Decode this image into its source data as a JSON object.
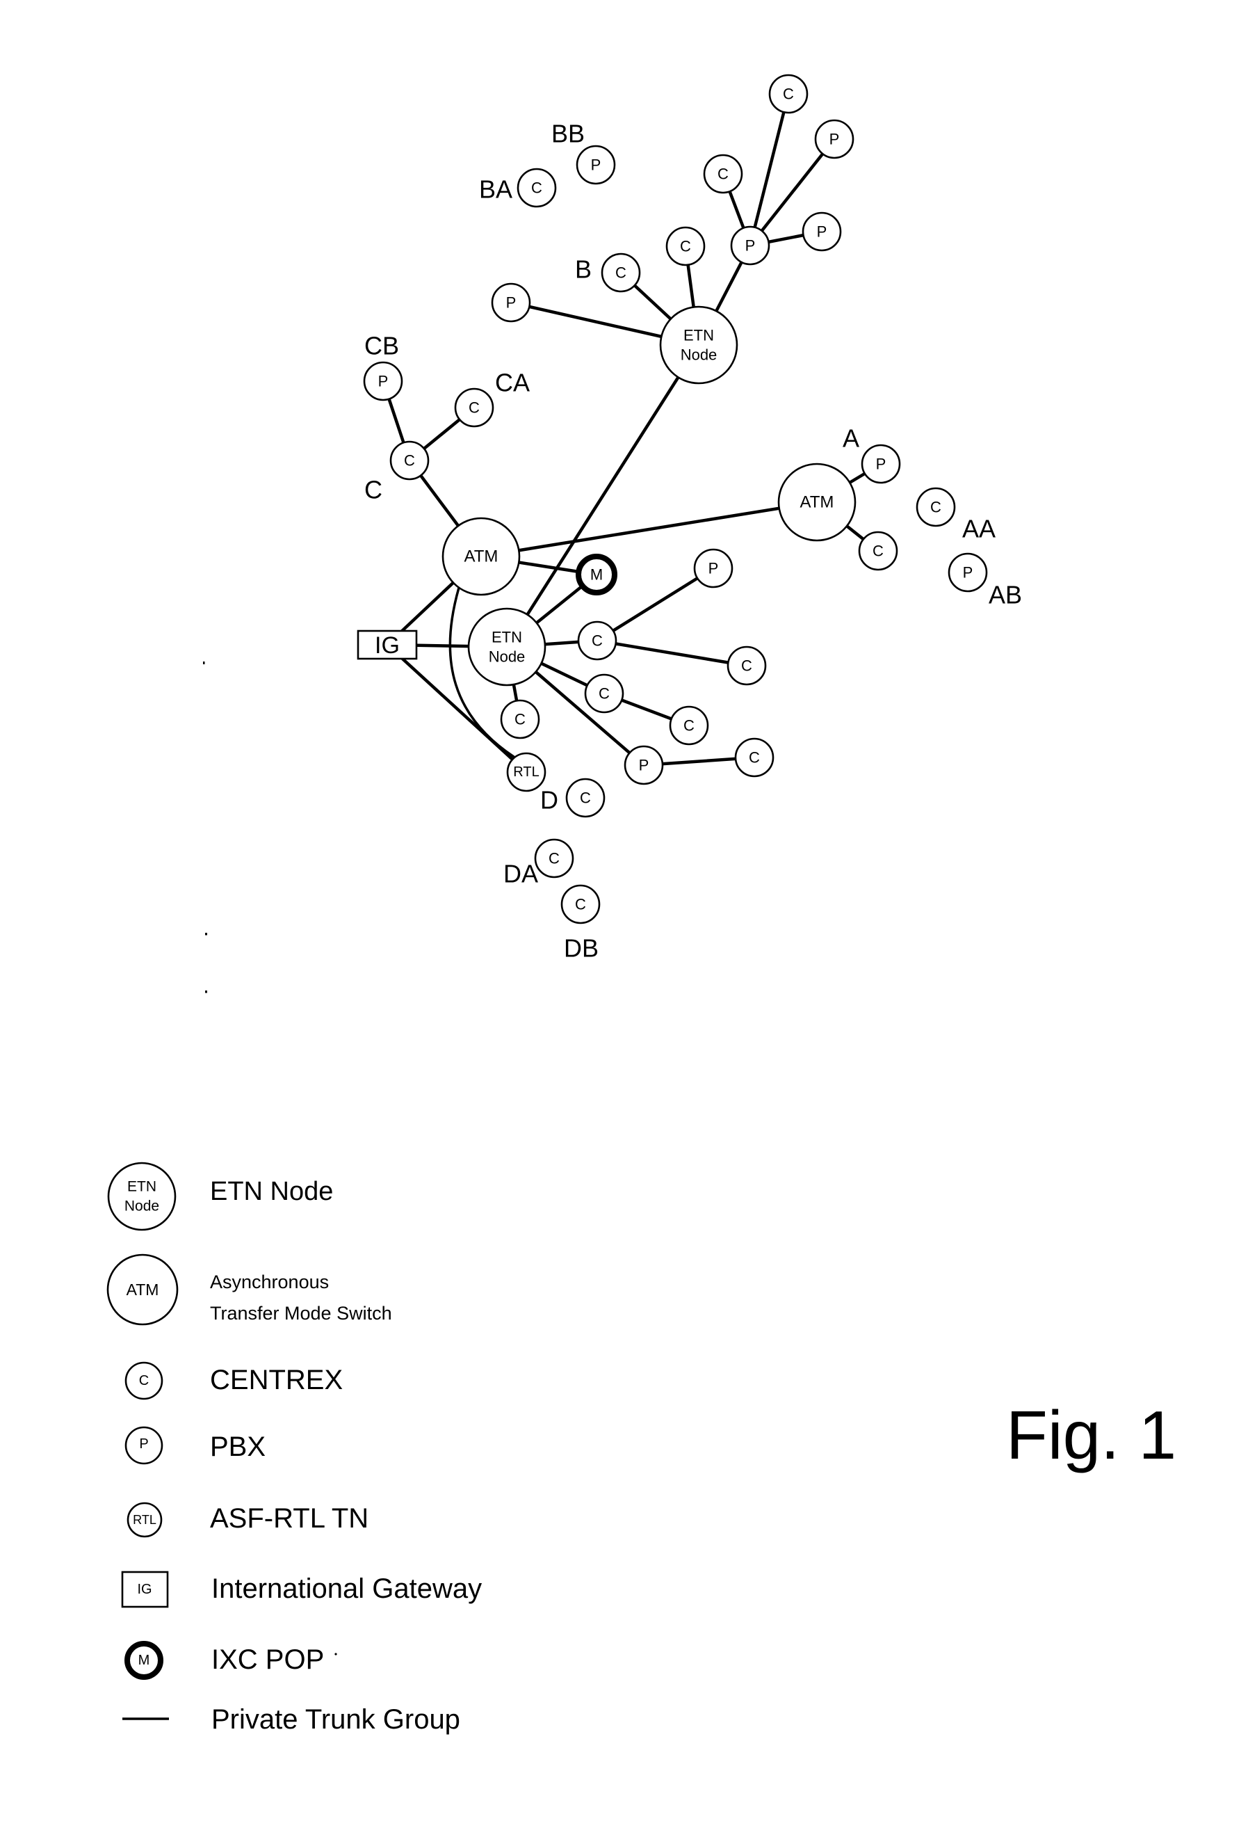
{
  "figure": {
    "title": "Fig. 1"
  },
  "node_types": {
    "etn": {
      "line1": "ETN",
      "line2": "Node"
    },
    "atm": {
      "line1": "ATM"
    },
    "centrex": {
      "line1": "C"
    },
    "pbx": {
      "line1": "P"
    },
    "rtl": {
      "line1": "RTL"
    },
    "ig": {
      "line1": "IG"
    },
    "ixc": {
      "line1": "M"
    }
  },
  "nodes": [
    {
      "id": "etn1",
      "type": "etn"
    },
    {
      "id": "etn2",
      "type": "etn"
    },
    {
      "id": "atm1",
      "type": "atm"
    },
    {
      "id": "atm2",
      "type": "atm"
    },
    {
      "id": "ig1",
      "type": "ig"
    },
    {
      "id": "m1",
      "type": "ixc"
    },
    {
      "id": "rtl1",
      "type": "rtl"
    },
    {
      "id": "b_p_hub",
      "type": "pbx"
    },
    {
      "id": "b_c_top",
      "type": "centrex"
    },
    {
      "id": "b_p_topright",
      "type": "pbx"
    },
    {
      "id": "b_c_mid",
      "type": "centrex"
    },
    {
      "id": "b_p_right",
      "type": "pbx"
    },
    {
      "id": "b_c_near",
      "type": "centrex"
    },
    {
      "id": "b_c",
      "type": "centrex",
      "group": "B"
    },
    {
      "id": "b_p_left",
      "type": "pbx"
    },
    {
      "id": "bb_p",
      "type": "pbx",
      "group": "BB"
    },
    {
      "id": "ba_c",
      "type": "centrex",
      "group": "BA"
    },
    {
      "id": "cb_p",
      "type": "pbx",
      "group": "CB"
    },
    {
      "id": "ca_c",
      "type": "centrex",
      "group": "CA"
    },
    {
      "id": "c_c",
      "type": "centrex",
      "group": "C"
    },
    {
      "id": "a_p",
      "type": "pbx",
      "group": "A"
    },
    {
      "id": "a_c",
      "type": "centrex"
    },
    {
      "id": "aa_c",
      "type": "centrex",
      "group": "AA"
    },
    {
      "id": "ab_p",
      "type": "pbx",
      "group": "AB"
    },
    {
      "id": "e_c1",
      "type": "centrex"
    },
    {
      "id": "e_p1",
      "type": "pbx"
    },
    {
      "id": "e_c2",
      "type": "centrex"
    },
    {
      "id": "e_c3",
      "type": "centrex"
    },
    {
      "id": "e_c4",
      "type": "centrex"
    },
    {
      "id": "e_c5",
      "type": "centrex"
    },
    {
      "id": "e_p2",
      "type": "pbx"
    },
    {
      "id": "e_c6",
      "type": "centrex"
    },
    {
      "id": "d_c",
      "type": "centrex",
      "group": "D"
    },
    {
      "id": "da_c",
      "type": "centrex",
      "group": "DA"
    },
    {
      "id": "db_c",
      "type": "centrex",
      "group": "DB"
    }
  ],
  "edges": [
    [
      "b_p_hub",
      "b_c_top"
    ],
    [
      "b_p_hub",
      "b_p_topright"
    ],
    [
      "b_p_hub",
      "b_c_mid"
    ],
    [
      "b_p_hub",
      "b_p_right"
    ],
    [
      "etn1",
      "b_p_hub"
    ],
    [
      "etn1",
      "b_c_near"
    ],
    [
      "etn1",
      "b_c"
    ],
    [
      "etn1",
      "b_p_left"
    ],
    [
      "etn1",
      "etn2"
    ],
    [
      "cb_p",
      "c_c"
    ],
    [
      "ca_c",
      "c_c"
    ],
    [
      "c_c",
      "atm1"
    ],
    [
      "atm1",
      "atm2"
    ],
    [
      "atm2",
      "a_p"
    ],
    [
      "atm2",
      "a_c"
    ],
    [
      "atm1",
      "m1"
    ],
    [
      "etn2",
      "m1"
    ],
    [
      "ig1",
      "atm1"
    ],
    [
      "ig1",
      "etn2"
    ],
    [
      "ig1",
      "rtl1"
    ],
    [
      "atm1",
      "rtl1",
      "curved"
    ],
    [
      "etn2",
      "e_c1"
    ],
    [
      "e_c1",
      "e_p1"
    ],
    [
      "e_c1",
      "e_c2"
    ],
    [
      "etn2",
      "e_c3"
    ],
    [
      "e_c3",
      "e_c4"
    ],
    [
      "etn2",
      "e_c5"
    ],
    [
      "etn2",
      "e_p2"
    ],
    [
      "e_p2",
      "e_c6"
    ]
  ],
  "legend": {
    "items": [
      {
        "symbol": "etn",
        "label": "ETN Node"
      },
      {
        "symbol": "atm",
        "label_line1": "Asynchronous",
        "label_line2": "Transfer Mode Switch"
      },
      {
        "symbol": "centrex",
        "label": "CENTREX"
      },
      {
        "symbol": "pbx",
        "label": "PBX"
      },
      {
        "symbol": "rtl",
        "label": "ASF-RTL TN"
      },
      {
        "symbol": "ig",
        "label": "International Gateway"
      },
      {
        "symbol": "ixc",
        "label": "IXC POP"
      },
      {
        "symbol": "trunk",
        "label": "Private Trunk Group"
      }
    ]
  },
  "colors": {
    "ink": "#000000",
    "paper": "#ffffff"
  }
}
